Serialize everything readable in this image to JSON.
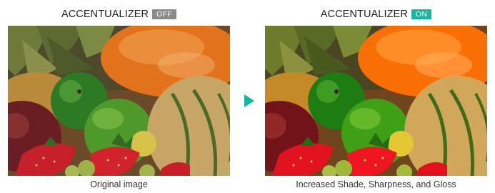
{
  "before": {
    "heading": "ACCENTUALIZER",
    "badge": "OFF",
    "badge_color": "#8a8a8a",
    "caption": "Original image"
  },
  "after": {
    "heading": "ACCENTUALIZER",
    "badge": "ON",
    "badge_color": "#16b79f",
    "caption": "Increased Shade, Sharpness, and Gloss"
  },
  "arrow": {
    "icon": "play-arrow-icon",
    "color": "#12b7a2"
  }
}
